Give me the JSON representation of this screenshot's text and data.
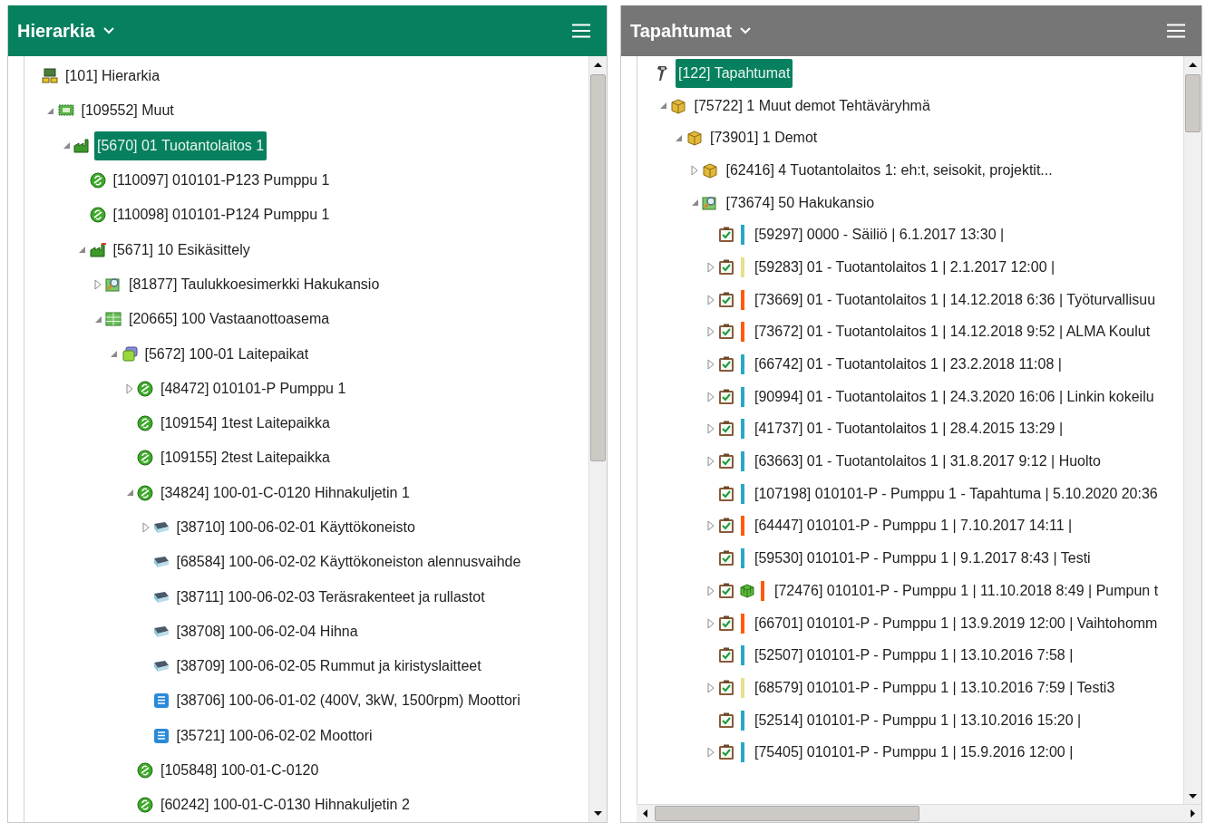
{
  "panels": [
    {
      "title": "Hierarkia",
      "active": true,
      "items": [
        {
          "label": "[101] Hierarkia",
          "kind": "hierarchy",
          "selected": false,
          "children": [
            {
              "label": "[109552] Muut",
              "kind": "group",
              "expanded": true,
              "selected": false,
              "children": [
                {
                  "label": "[5670] 01 Tuotantolaitos 1",
                  "kind": "factory",
                  "expanded": true,
                  "selected": true,
                  "children": [
                    {
                      "label": "[110097] 010101-P123 Pumppu 1",
                      "kind": "pump",
                      "selected": false
                    },
                    {
                      "label": "[110098] 010101-P124 Pumppu 1",
                      "kind": "pump",
                      "selected": false
                    },
                    {
                      "label": "[5671] 10 Esikäsittely",
                      "kind": "factory-small",
                      "expanded": true,
                      "selected": false,
                      "children": [
                        {
                          "label": "[81877] Taulukkoesimerkki Hakukansio",
                          "kind": "search-folder",
                          "expanded": false,
                          "selected": false
                        },
                        {
                          "label": "[20665] 100 Vastaanottoasema",
                          "kind": "station",
                          "expanded": true,
                          "selected": false,
                          "children": [
                            {
                              "label": "[5672] 100-01 Laitepaikat",
                              "kind": "layers",
                              "expanded": true,
                              "selected": false,
                              "children": [
                                {
                                  "label": "[48472] 010101-P Pumppu 1",
                                  "kind": "pump",
                                  "expanded": false,
                                  "selected": false
                                },
                                {
                                  "label": "[109154] 1test Laitepaikka",
                                  "kind": "pump",
                                  "selected": false
                                },
                                {
                                  "label": "[109155] 2test Laitepaikka",
                                  "kind": "pump",
                                  "selected": false
                                },
                                {
                                  "label": "[34824] 100-01-C-0120 Hihnakuljetin 1",
                                  "kind": "pump",
                                  "expanded": true,
                                  "selected": false,
                                  "children": [
                                    {
                                      "label": "[38710] 100-06-02-01 Käyttökoneisto",
                                      "kind": "device",
                                      "expanded": false,
                                      "selected": false
                                    },
                                    {
                                      "label": "[68584] 100-06-02-02 Käyttökoneiston alennusvaihde",
                                      "kind": "device",
                                      "selected": false
                                    },
                                    {
                                      "label": "[38711] 100-06-02-03 Teräsrakenteet ja rullastot",
                                      "kind": "device",
                                      "selected": false
                                    },
                                    {
                                      "label": "[38708] 100-06-02-04 Hihna",
                                      "kind": "device",
                                      "selected": false
                                    },
                                    {
                                      "label": "[38709] 100-06-02-05 Rummut ja kiristyslaitteet",
                                      "kind": "device",
                                      "selected": false
                                    },
                                    {
                                      "label": "[38706] 100-06-01-02  (400V, 3kW, 1500rpm) Moottori",
                                      "kind": "document",
                                      "selected": false
                                    },
                                    {
                                      "label": "[35721] 100-06-02-02 Moottori",
                                      "kind": "document",
                                      "selected": false
                                    }
                                  ]
                                },
                                {
                                  "label": "[105848] 100-01-C-0120",
                                  "kind": "pump",
                                  "selected": false
                                },
                                {
                                  "label": "[60242] 100-01-C-0130 Hihnakuljetin 2",
                                  "kind": "pump",
                                  "selected": false
                                }
                              ]
                            }
                          ]
                        }
                      ]
                    }
                  ]
                }
              ]
            }
          ]
        }
      ]
    },
    {
      "title": "Tapahtumat",
      "active": false,
      "items": [
        {
          "label": "[122] Tapahtumat",
          "kind": "tool",
          "selected": true,
          "children": [
            {
              "label": "[75722] 1 Muut demot Tehtäväryhmä",
              "kind": "box",
              "expanded": true,
              "selected": false,
              "children": [
                {
                  "label": "[73901] 1 Demot",
                  "kind": "box",
                  "expanded": true,
                  "selected": false,
                  "children": [
                    {
                      "label": "[62416] 4 Tuotantolaitos 1: eh:t, seisokit, projektit...",
                      "kind": "box",
                      "expanded": false,
                      "selected": false
                    },
                    {
                      "label": "[73674] 50 Hakukansio",
                      "kind": "search-folder",
                      "expanded": true,
                      "selected": false,
                      "children": [
                        {
                          "label": "[59297] 0000 - Säiliö | 6.1.2017 13:30 |",
                          "kind": "event",
                          "selected": false,
                          "color": "#2aa7c9"
                        },
                        {
                          "label": "[59283] 01 - Tuotantolaitos 1 | 2.1.2017 12:00 |",
                          "kind": "event",
                          "expanded": false,
                          "selected": false,
                          "color": "#e8e08e"
                        },
                        {
                          "label": "[73669] 01 - Tuotantolaitos 1 | 14.12.2018 6:36 | Työturvallisuu",
                          "kind": "event",
                          "expanded": false,
                          "selected": false,
                          "color": "#ff5a0a"
                        },
                        {
                          "label": "[73672] 01 - Tuotantolaitos 1 | 14.12.2018 9:52 | ALMA Koulut",
                          "kind": "event",
                          "expanded": false,
                          "selected": false,
                          "color": "#ff5a0a"
                        },
                        {
                          "label": "[66742] 01 - Tuotantolaitos 1 | 23.2.2018 11:08 |",
                          "kind": "event",
                          "expanded": false,
                          "selected": false,
                          "color": "#2aa7c9"
                        },
                        {
                          "label": "[90994] 01 - Tuotantolaitos 1 | 24.3.2020 16:06 | Linkin kokeilu",
                          "kind": "event",
                          "expanded": false,
                          "selected": false,
                          "color": "#2aa7c9"
                        },
                        {
                          "label": "[41737] 01 - Tuotantolaitos 1 | 28.4.2015 13:29 |",
                          "kind": "event",
                          "expanded": false,
                          "selected": false,
                          "color": "#2aa7c9"
                        },
                        {
                          "label": "[63663] 01 - Tuotantolaitos 1 | 31.8.2017 9:12 | Huolto",
                          "kind": "event",
                          "expanded": false,
                          "selected": false,
                          "color": "#2aa7c9"
                        },
                        {
                          "label": "[107198] 010101-P - Pumppu 1 - Tapahtuma | 5.10.2020 20:36",
                          "kind": "event",
                          "selected": false,
                          "color": "#2aa7c9"
                        },
                        {
                          "label": "[64447] 010101-P - Pumppu 1 | 7.10.2017 14:11 |",
                          "kind": "event",
                          "expanded": false,
                          "selected": false,
                          "color": "#ff5a0a"
                        },
                        {
                          "label": "[59530] 010101-P - Pumppu 1 | 9.1.2017 8:43 | Testi",
                          "kind": "event",
                          "selected": false,
                          "color": "#2aa7c9"
                        },
                        {
                          "label": "[72476] 010101-P - Pumppu 1 | 11.10.2018 8:49 | Pumpun t",
                          "kind": "event-cube",
                          "expanded": false,
                          "selected": false,
                          "color": "#ff5a0a"
                        },
                        {
                          "label": "[66701] 010101-P - Pumppu 1 | 13.9.2019 12:00 | Vaihtohomm",
                          "kind": "event",
                          "expanded": false,
                          "selected": false,
                          "color": "#ff5a0a"
                        },
                        {
                          "label": "[52507] 010101-P - Pumppu 1 | 13.10.2016 7:58 |",
                          "kind": "event",
                          "selected": false,
                          "color": "#2aa7c9"
                        },
                        {
                          "label": "[68579] 010101-P - Pumppu 1 | 13.10.2016 7:59 | Testi3",
                          "kind": "event",
                          "expanded": false,
                          "selected": false,
                          "color": "#e8e08e"
                        },
                        {
                          "label": "[52514] 010101-P - Pumppu 1 | 13.10.2016 15:20 |",
                          "kind": "event",
                          "selected": false,
                          "color": "#2aa7c9"
                        },
                        {
                          "label": "[75405] 010101-P - Pumppu 1 | 15.9.2016 12:00 |",
                          "kind": "event",
                          "expanded": false,
                          "selected": false,
                          "color": "#2aa7c9"
                        }
                      ]
                    }
                  ]
                }
              ]
            }
          ]
        }
      ]
    }
  ]
}
